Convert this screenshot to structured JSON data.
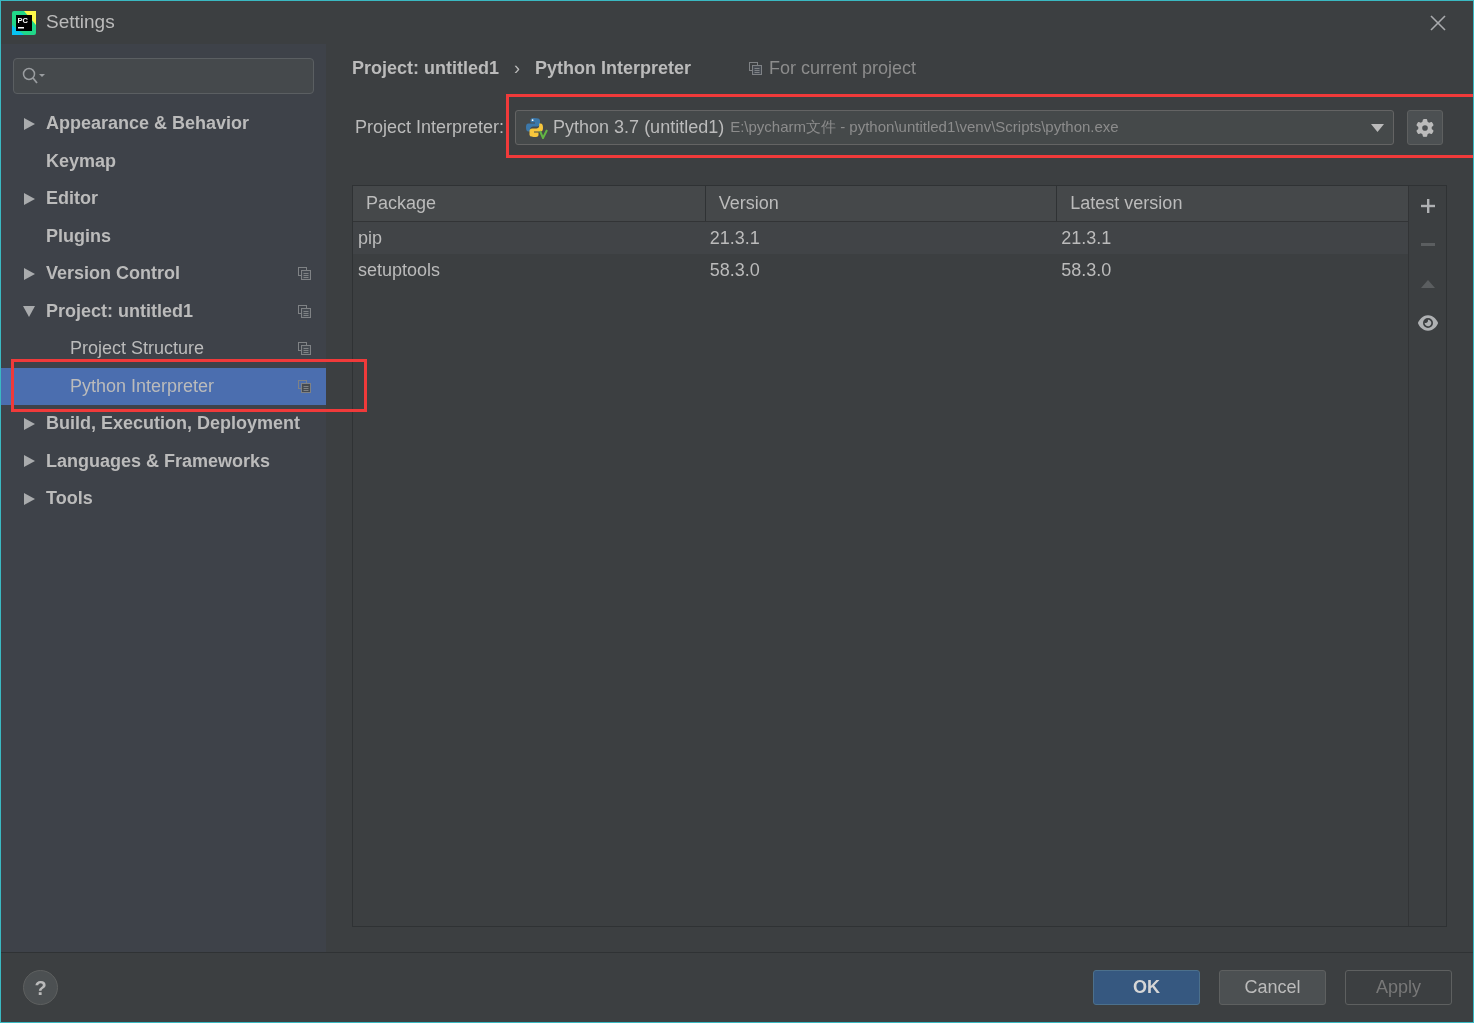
{
  "window": {
    "title": "Settings",
    "app_icon_text": "PC"
  },
  "sidebar": {
    "items": [
      {
        "label": "Appearance & Behavior",
        "kind": "group",
        "expanded": false,
        "selected": false,
        "project_scoped": false,
        "highlighted": false
      },
      {
        "label": "Keymap",
        "kind": "page",
        "selected": false,
        "project_scoped": false,
        "highlighted": false
      },
      {
        "label": "Editor",
        "kind": "group",
        "expanded": false,
        "selected": false,
        "project_scoped": false,
        "highlighted": false
      },
      {
        "label": "Plugins",
        "kind": "page",
        "selected": false,
        "project_scoped": false,
        "highlighted": false
      },
      {
        "label": "Version Control",
        "kind": "group",
        "expanded": false,
        "selected": false,
        "project_scoped": true,
        "highlighted": false
      },
      {
        "label": "Project: untitled1",
        "kind": "group",
        "expanded": true,
        "selected": false,
        "project_scoped": true,
        "highlighted": false,
        "children": [
          {
            "label": "Project Structure",
            "kind": "page",
            "selected": false,
            "project_scoped": true,
            "highlighted": false
          },
          {
            "label": "Python Interpreter",
            "kind": "page",
            "selected": true,
            "project_scoped": true,
            "highlighted": true
          }
        ]
      },
      {
        "label": "Build, Execution, Deployment",
        "kind": "group",
        "expanded": false,
        "selected": false,
        "project_scoped": false,
        "highlighted": false
      },
      {
        "label": "Languages & Frameworks",
        "kind": "group",
        "expanded": false,
        "selected": false,
        "project_scoped": false,
        "highlighted": false
      },
      {
        "label": "Tools",
        "kind": "group",
        "expanded": false,
        "selected": false,
        "project_scoped": false,
        "highlighted": false
      }
    ]
  },
  "header": {
    "breadcrumb": [
      "Project: untitled1",
      "Python Interpreter"
    ],
    "separator": "›",
    "scope_note": "For current project"
  },
  "interpreter": {
    "label": "Project Interpreter:",
    "name": "Python 3.7 (untitled1)",
    "path": "E:\\pycharm文件 - python\\untitled1\\venv\\Scripts\\python.exe",
    "highlighted": true
  },
  "packages": {
    "columns": [
      "Package",
      "Version",
      "Latest version"
    ],
    "rows": [
      [
        "pip",
        "21.3.1",
        "21.3.1"
      ],
      [
        "setuptools",
        "58.3.0",
        "58.3.0"
      ]
    ],
    "tools": [
      {
        "kind": "add",
        "disabled": false
      },
      {
        "kind": "remove",
        "disabled": true
      },
      {
        "kind": "upgrade",
        "disabled": true
      },
      {
        "kind": "show",
        "disabled": false
      }
    ]
  },
  "help": "?",
  "buttons": [
    {
      "label": "OK",
      "kind": "primary",
      "disabled": false
    },
    {
      "label": "Cancel",
      "kind": "normal",
      "disabled": false
    },
    {
      "label": "Apply",
      "kind": "normal",
      "disabled": true
    }
  ]
}
